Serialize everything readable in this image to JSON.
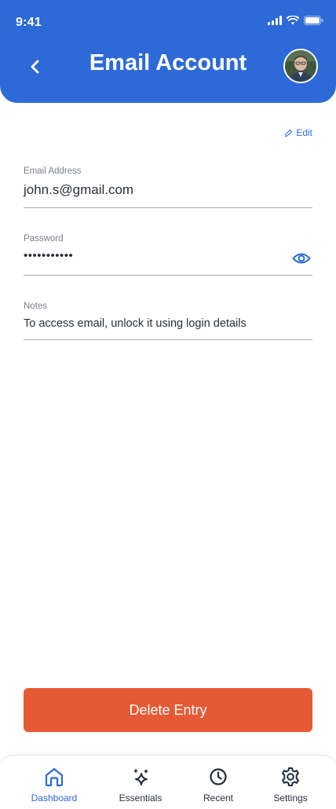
{
  "status_bar": {
    "time": "9:41"
  },
  "header": {
    "title": "Email Account"
  },
  "actions": {
    "edit_label": "Edit",
    "delete_label": "Delete Entry"
  },
  "fields": {
    "email": {
      "label": "Email Address",
      "value": "john.s@gmail.com"
    },
    "password": {
      "label": "Password",
      "value": "•••••••••••"
    },
    "notes": {
      "label": "Notes",
      "value": "To access email, unlock it using login details"
    }
  },
  "tabs": [
    {
      "label": "Dashboard",
      "icon": "home-icon",
      "active": true
    },
    {
      "label": "Essentials",
      "icon": "sparkles-icon",
      "active": false
    },
    {
      "label": "Recent",
      "icon": "clock-icon",
      "active": false
    },
    {
      "label": "Settings",
      "icon": "gear-icon",
      "active": false
    }
  ],
  "colors": {
    "primary": "#2d6ad8",
    "danger": "#e55a35",
    "text": "#2a2f3a",
    "muted": "#7a7f89"
  }
}
